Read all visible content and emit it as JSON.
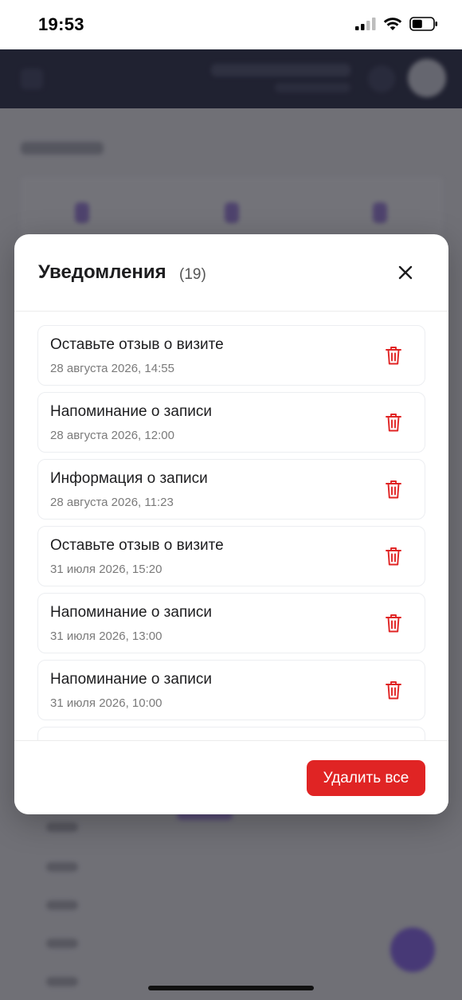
{
  "status_bar": {
    "time": "19:53"
  },
  "modal": {
    "title": "Уведомления",
    "count": "(19)",
    "notifications": [
      {
        "title": "Оставьте отзыв о визите",
        "date": "28 августа 2026, 14:55"
      },
      {
        "title": "Напоминание о записи",
        "date": "28 августа 2026, 12:00"
      },
      {
        "title": "Информация о записи",
        "date": "28 августа 2026, 11:23"
      },
      {
        "title": "Оставьте отзыв о визите",
        "date": "31 июля 2026, 15:20"
      },
      {
        "title": "Напоминание о записи",
        "date": "31 июля 2026, 13:00"
      },
      {
        "title": "Напоминание о записи",
        "date": "31 июля 2026, 10:00"
      }
    ],
    "delete_all_label": "Удалить все"
  },
  "colors": {
    "accent_red": "#e02424",
    "header_dark": "#141833"
  },
  "icons": {
    "close": "close-icon",
    "trash": "trash-icon"
  }
}
